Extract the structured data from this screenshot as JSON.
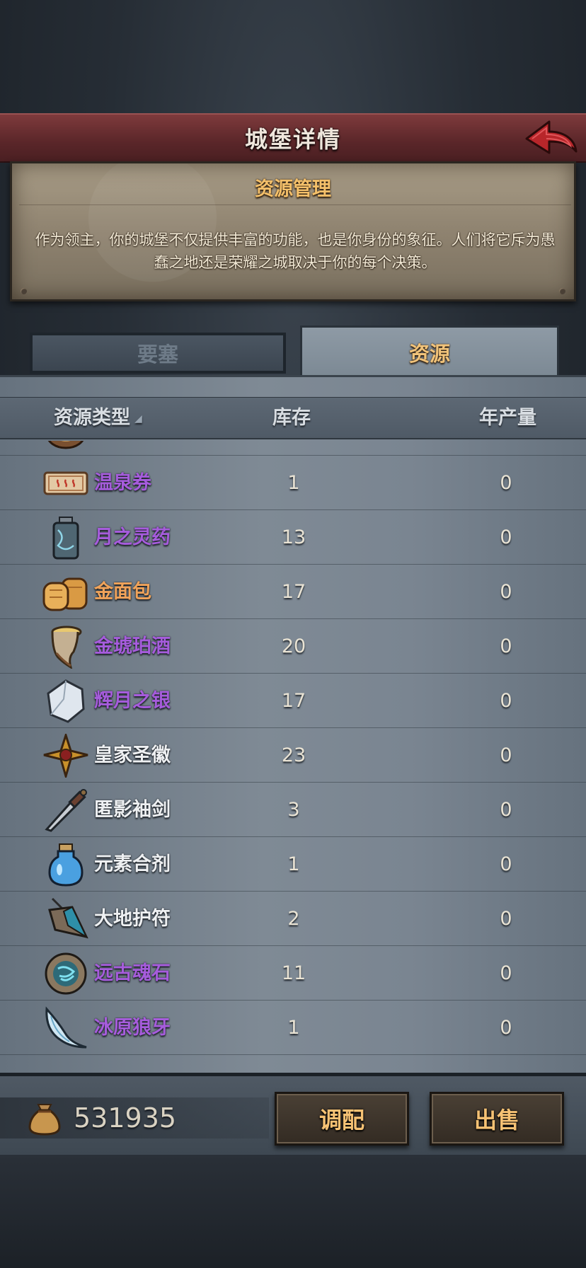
{
  "header": {
    "title": "城堡详情"
  },
  "info": {
    "title": "资源管理",
    "description": "作为领主，你的城堡不仅提供丰富的功能，也是你身份的象征。人们将它斥为愚蠢之地还是荣耀之城取决于你的每个决策。"
  },
  "tabs": [
    {
      "label": "要塞",
      "active": false
    },
    {
      "label": "资源",
      "active": true
    }
  ],
  "table": {
    "columns": {
      "type": "资源类型",
      "stock": "库存",
      "production": "年产量"
    },
    "rows": [
      {
        "name": "温泉券",
        "stock": "1",
        "production": "0",
        "icon": "hot-spring-ticket-icon",
        "rarity": "purple"
      },
      {
        "name": "月之灵药",
        "stock": "13",
        "production": "0",
        "icon": "moon-elixir-icon",
        "rarity": "purple"
      },
      {
        "name": "金面包",
        "stock": "17",
        "production": "0",
        "icon": "golden-bread-icon",
        "rarity": "orange"
      },
      {
        "name": "金琥珀酒",
        "stock": "20",
        "production": "0",
        "icon": "amber-horn-icon",
        "rarity": "purple"
      },
      {
        "name": "辉月之银",
        "stock": "17",
        "production": "0",
        "icon": "moon-silver-icon",
        "rarity": "purple"
      },
      {
        "name": "皇家圣徽",
        "stock": "23",
        "production": "0",
        "icon": "royal-emblem-icon",
        "rarity": "white"
      },
      {
        "name": "匿影袖剑",
        "stock": "3",
        "production": "0",
        "icon": "hidden-blade-icon",
        "rarity": "white"
      },
      {
        "name": "元素合剂",
        "stock": "1",
        "production": "0",
        "icon": "elemental-potion-icon",
        "rarity": "white"
      },
      {
        "name": "大地护符",
        "stock": "2",
        "production": "0",
        "icon": "earth-amulet-icon",
        "rarity": "white"
      },
      {
        "name": "远古魂石",
        "stock": "11",
        "production": "0",
        "icon": "ancient-soulstone-icon",
        "rarity": "purple"
      },
      {
        "name": "冰原狼牙",
        "stock": "1",
        "production": "0",
        "icon": "frost-wolf-fang-icon",
        "rarity": "purple"
      }
    ]
  },
  "footer": {
    "gold": "531935",
    "adjust_label": "调配",
    "sell_label": "出售"
  },
  "colors": {
    "purple": "#a65cdc",
    "orange": "#f0a35a",
    "white": "#eef0f2",
    "accent_gold": "#f6c274",
    "banner": "#5a2629"
  }
}
